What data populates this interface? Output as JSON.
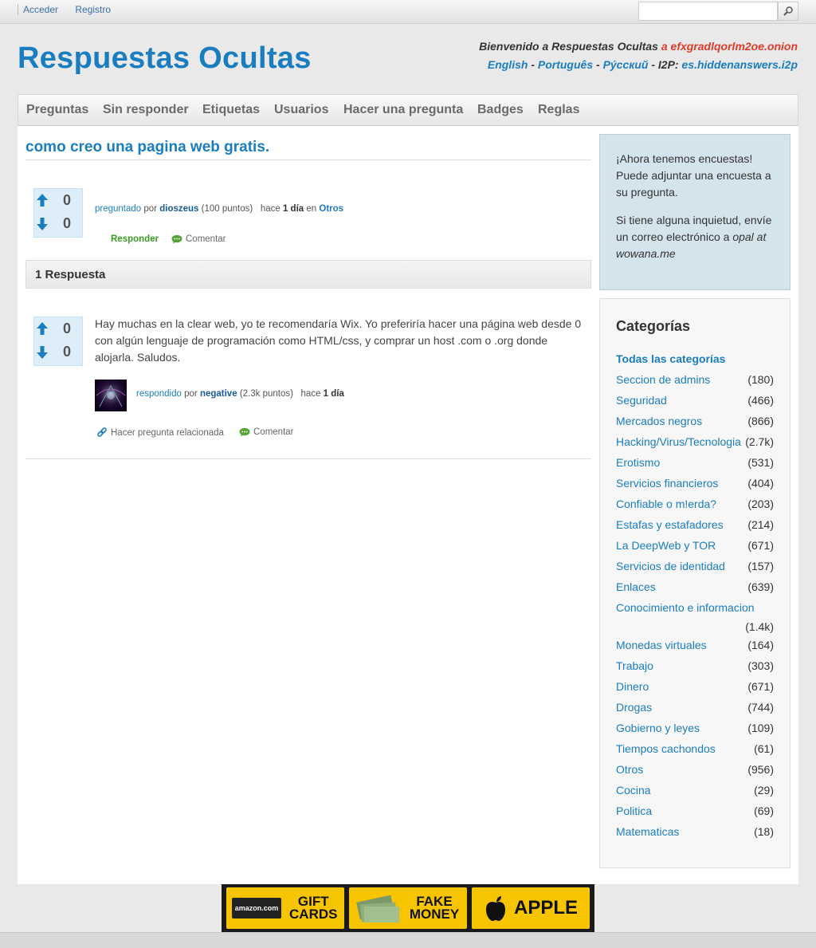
{
  "topbar": {
    "login": "Acceder",
    "register": "Registro",
    "search_placeholder": ""
  },
  "header": {
    "logo": "Respuestas Ocultas",
    "welcome_prefix": "Bienvenido a Respuestas Ocultas",
    "welcome_onion": "a efxgradlqorlm2oe.onion",
    "lang_english": "English",
    "lang_portugues": "Português",
    "lang_russian": "Рýсский",
    "i2p_label": "I2P:",
    "i2p_link": "es.hiddenanswers.i2p",
    "sep": "-"
  },
  "nav": {
    "items": [
      "Preguntas",
      "Sin responder",
      "Etiquetas",
      "Usuarios",
      "Hacer una pregunta",
      "Badges",
      "Reglas"
    ]
  },
  "question": {
    "title": "como creo una pagina web gratis.",
    "votes_up": "0",
    "votes_down": "0",
    "asked": "preguntado",
    "by": "por",
    "author": "dioszeus",
    "points": "(100 puntos)",
    "ago": "hace",
    "time": "1 día",
    "in": "en",
    "category": "Otros",
    "answer_btn": "Responder",
    "comment_btn": "Comentar"
  },
  "answers": {
    "count_label": "1 Respuesta",
    "items": [
      {
        "votes_up": "0",
        "votes_down": "0",
        "text": "Hay muchas en la clear web, yo te recomendaría Wix. Yo preferiría hacer una página web desde 0 con algún lenguaje de programación como HTML/css, y comprar un host .com o .org donde alojarla. Saludos.",
        "answered": "respondido",
        "by": "por",
        "author": "negative",
        "points": "(2.3k puntos)",
        "ago": "hace",
        "time": "1 día",
        "related_btn": "Hacer pregunta relacionada",
        "comment_btn": "Comentar"
      }
    ]
  },
  "sidebar": {
    "poll_p1": "¡Ahora tenemos encuestas! Puede adjuntar una encuesta a su pregunta.",
    "poll_p2_text": "Si tiene alguna inquietud, envíe un correo electrónico a",
    "poll_p2_email": "opal at wowana.me",
    "categories_title": "Categorías",
    "all_categories": "Todas las categorías",
    "categories": [
      {
        "name": "Seccion de admins",
        "count": "(180)"
      },
      {
        "name": "Seguridad",
        "count": "(466)"
      },
      {
        "name": "Mercados negros",
        "count": "(866)"
      },
      {
        "name": "Hacking/Virus/Tecnologia",
        "count": "(2.7k)"
      },
      {
        "name": "Erotismo",
        "count": "(531)"
      },
      {
        "name": "Servicios financieros",
        "count": "(404)"
      },
      {
        "name": "Confiable o m!erda?",
        "count": "(203)"
      },
      {
        "name": "Estafas y estafadores",
        "count": "(214)"
      },
      {
        "name": "La DeepWeb y TOR",
        "count": "(671)"
      },
      {
        "name": "Servicios de identidad",
        "count": "(157)"
      },
      {
        "name": "Enlaces",
        "count": "(639)"
      },
      {
        "name": "Conocimiento e informacion",
        "count": "(1.4k)"
      },
      {
        "name": "Monedas virtuales",
        "count": "(164)"
      },
      {
        "name": "Trabajo",
        "count": "(303)"
      },
      {
        "name": "Dinero",
        "count": "(671)"
      },
      {
        "name": "Drogas",
        "count": "(744)"
      },
      {
        "name": "Gobierno y leyes",
        "count": "(109)"
      },
      {
        "name": "Tiempos cachondos",
        "count": "(61)"
      },
      {
        "name": "Otros",
        "count": "(956)"
      },
      {
        "name": "Cocina",
        "count": "(29)"
      },
      {
        "name": "Politica",
        "count": "(69)"
      },
      {
        "name": "Matematicas",
        "count": "(18)"
      }
    ]
  },
  "banner": {
    "amazon": "amazon.com",
    "gift_cards": "GIFT CARDS",
    "fake_money": "FAKE MONEY",
    "apple": "APPLE"
  },
  "colors": {
    "link": "#1a7dbf",
    "vote_arrow": "#1a7dbf",
    "answer_green": "#3a9d23",
    "onion_red": "#e03a2a"
  }
}
